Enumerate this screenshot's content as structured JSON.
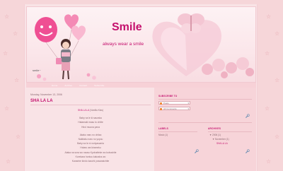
{
  "header": {
    "title": "Smile",
    "description": "always wear a smile",
    "girl_badge": "smile~"
  },
  "nav": {
    "links": [
      "Home",
      "Archive",
      "Contact",
      "Subscribe"
    ]
  },
  "post": {
    "date": "Monday, November 13, 2006",
    "title": "SHA LA LA",
    "credit_artist": "SHA LA LA",
    "credit_rest": "(Vanilla Kiss)",
    "lines": [
      "Baby na le ki sauraka",
      "Hatamaki masu to chitte",
      "Hiroi muuna yana",
      "",
      "Akaku naru no chiisa",
      "Nakitaku naru no yoyuu",
      "Baby na le ni noriyasumia",
      "Hotaru wa kirameku",
      "Ataka na sora wo naosu Kyohatteke wo kobushite",
      "Korekara hontou kakusha wo",
      "Kanarine kindo kaochi yuwanaichite"
    ]
  },
  "sidebar": {
    "subscribe_heading": "SUBSCRIBE TO",
    "subscribe_posts": "Posts",
    "subscribe_comments": "All Comments",
    "labels_heading": "LABELS",
    "labels": [
      "Music (1)"
    ],
    "archives_heading": "ARCHIVES",
    "archive_year": "2006 (1)",
    "archive_month": "November (1)",
    "archive_post": "SHA LA LA"
  },
  "colors": {
    "accent": "#c4106d",
    "page_bg": "#f6d6d9",
    "panel_bg": "#f9e3e6",
    "sidebar_bg": "#f7d4d9",
    "text": "#8a6870"
  }
}
